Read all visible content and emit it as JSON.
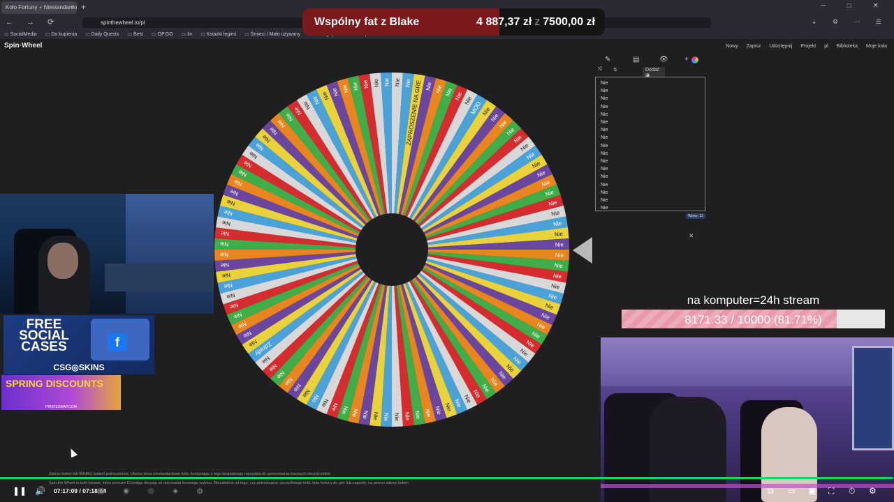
{
  "browser": {
    "tab_title": "Koło Fortuny ⋆ Niestandardowe",
    "tab_close": "×",
    "new_tab": "+",
    "window_controls": "─ □ ✕",
    "nav_buttons": "← → ⟳",
    "url": "spinthewheel.io/pl",
    "url_icons": "⇣ ⚙ ⋯ ☰",
    "bookmarks": [
      "SocialMedia",
      "Do kupienia",
      "Daily Quests",
      "Bets",
      "OP.GG",
      "tiv",
      "Ksiazki legimi",
      "Śmieci / Mało używany",
      "Do Oglądania",
      "Naprac..."
    ]
  },
  "donation": {
    "title": "Wspólny fat z Blake",
    "current": "4 887,37 zł",
    "separator": "z",
    "target": "7500,00 zł",
    "fraction": 0.6517
  },
  "site": {
    "logo": "Spin·Wheel",
    "nav": [
      "Nowy",
      "Zapisz",
      "Udostępnij",
      "Projekt",
      "pl",
      "Biblioteka",
      "Moje koła"
    ]
  },
  "wheel": {
    "default_label": "Nie",
    "special_labels": [
      {
        "index": 2,
        "text": "ZAPROSZENIE NA GRE"
      },
      {
        "index": 8,
        "text": "MOD"
      },
      {
        "index": 64,
        "text": "Zdrady"
      }
    ],
    "segment_count": 100,
    "colors": [
      "#d8d8d8",
      "#4aa2d8",
      "#e9d23a",
      "#6b46a0",
      "#e8851f",
      "#3fae49",
      "#d62c2f"
    ]
  },
  "panel": {
    "tool_icons": [
      "✎",
      "▤",
      "👁",
      "+"
    ],
    "shuffle_icon": "⤭",
    "sort_icon": "⇅",
    "add_label": "Dodać ▣",
    "entries": [
      "Nie",
      "Nie",
      "Nie",
      "Nie",
      "Nie",
      "Nie",
      "Nie",
      "Nie",
      "Nie",
      "Nie",
      "Nie",
      "Nie",
      "Nie",
      "Nie",
      "Nie",
      "Nie",
      "Nie"
    ],
    "entry_count_badge": "Wpisy: 11",
    "close": "✕"
  },
  "goal": {
    "title": "na komputer=24h stream",
    "text": "8171.33 / 10000 (81.71%)",
    "fraction": 0.8171
  },
  "ads": {
    "ad1_text": "FREE SOCIAL CASES",
    "ad1_brand": "CSG◎SKINS",
    "ad1_fb": "f",
    "ad2_text": "SPRING DISCOUNTS",
    "ad2_site": "PIRATESWAP.COM"
  },
  "page_text": [
    "Zakręć kołem lub WHEEL kołami jednocześnie. Utwórz teraz niestandardowe koło, korzystając z tego bezpłatnego narzędzia do generowania losowych decyzji online.",
    "Spin the Wheel to koło losowe, które pomoże Ci podjąć decyzję od dokonania losowego wyboru. Niezależnie od tego, czy potrzebujesz szczęśliwego koła, koła fortuny do gier lub nagrody, na pewno zakręć kołem."
  ],
  "player": {
    "time": "07:17:09 / 07:18:14",
    "progress_fraction": 0.9985,
    "pause_icon": "❚❚",
    "volume_icon": "🔊",
    "taskbar_icons": "▣ ◉ ◎ ◈ ◍",
    "right_icons": [
      "⧉",
      "▭",
      "▣",
      "⛶",
      "⏱",
      "⚙"
    ]
  }
}
